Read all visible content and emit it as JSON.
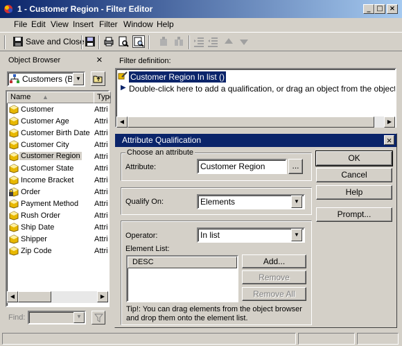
{
  "window": {
    "title": "1 - Customer Region - Filter Editor",
    "buttons": {
      "minimize": "_",
      "maximize": "□",
      "close": "×"
    }
  },
  "menu": {
    "items": [
      {
        "label": "File"
      },
      {
        "label": "Edit"
      },
      {
        "label": "View"
      },
      {
        "label": "Insert"
      },
      {
        "label": "Filter"
      },
      {
        "label": "Window"
      },
      {
        "label": "Help"
      }
    ]
  },
  "toolbar": {
    "save_close_label": "Save and Close"
  },
  "object_browser": {
    "title": "Object Browser",
    "close": "×",
    "folder_value": "Customers (Bro",
    "columns": [
      "Name",
      "Type"
    ],
    "rows": [
      {
        "name": "Customer",
        "type": "Attri",
        "icon": "attribute-icon"
      },
      {
        "name": "Customer Age",
        "type": "Attri",
        "icon": "attribute-icon"
      },
      {
        "name": "Customer Birth Date",
        "type": "Attri",
        "icon": "attribute-icon"
      },
      {
        "name": "Customer City",
        "type": "Attri",
        "icon": "attribute-icon"
      },
      {
        "name": "Customer Region",
        "type": "Attri",
        "icon": "attribute-icon",
        "selected": true
      },
      {
        "name": "Customer State",
        "type": "Attri",
        "icon": "attribute-icon"
      },
      {
        "name": "Income Bracket",
        "type": "Attri",
        "icon": "attribute-icon"
      },
      {
        "name": "Order",
        "type": "Attri",
        "icon": "locked-attribute-icon"
      },
      {
        "name": "Payment Method",
        "type": "Attri",
        "icon": "attribute-icon"
      },
      {
        "name": "Rush Order",
        "type": "Attri",
        "icon": "attribute-icon"
      },
      {
        "name": "Ship Date",
        "type": "Attri",
        "icon": "attribute-icon"
      },
      {
        "name": "Shipper",
        "type": "Attri",
        "icon": "attribute-icon"
      },
      {
        "name": "Zip Code",
        "type": "Attri",
        "icon": "attribute-icon"
      }
    ],
    "find_label": "Find:"
  },
  "filter_definition": {
    "title": "Filter definition:",
    "condition": "Customer Region In list ()",
    "hint": "Double-click here to add a qualification, or drag an object from the object brows"
  },
  "dialog": {
    "title": "Attribute Qualification",
    "close": "×",
    "choose_group": "Choose an attribute",
    "attribute_label": "Attribute:",
    "attribute_value": "Customer Region",
    "browse": "...",
    "qualify_label": "Qualify On:",
    "qualify_value": "Elements",
    "operator_label": "Operator:",
    "operator_value": "In list",
    "element_list_label": "Element List:",
    "element_list": [
      "DESC"
    ],
    "add": "Add...",
    "remove": "Remove",
    "remove_all": "Remove All",
    "tip": "Tip!:  You can drag elements from the object browser and drop them onto the element list.",
    "ok": "OK",
    "cancel": "Cancel",
    "help": "Help",
    "prompt": "Prompt..."
  },
  "colors": {
    "title_active": "#0a246a",
    "title_gradient_end": "#a6caf0",
    "face": "#d4d0c8",
    "attribute_icon": "#e8b800"
  }
}
